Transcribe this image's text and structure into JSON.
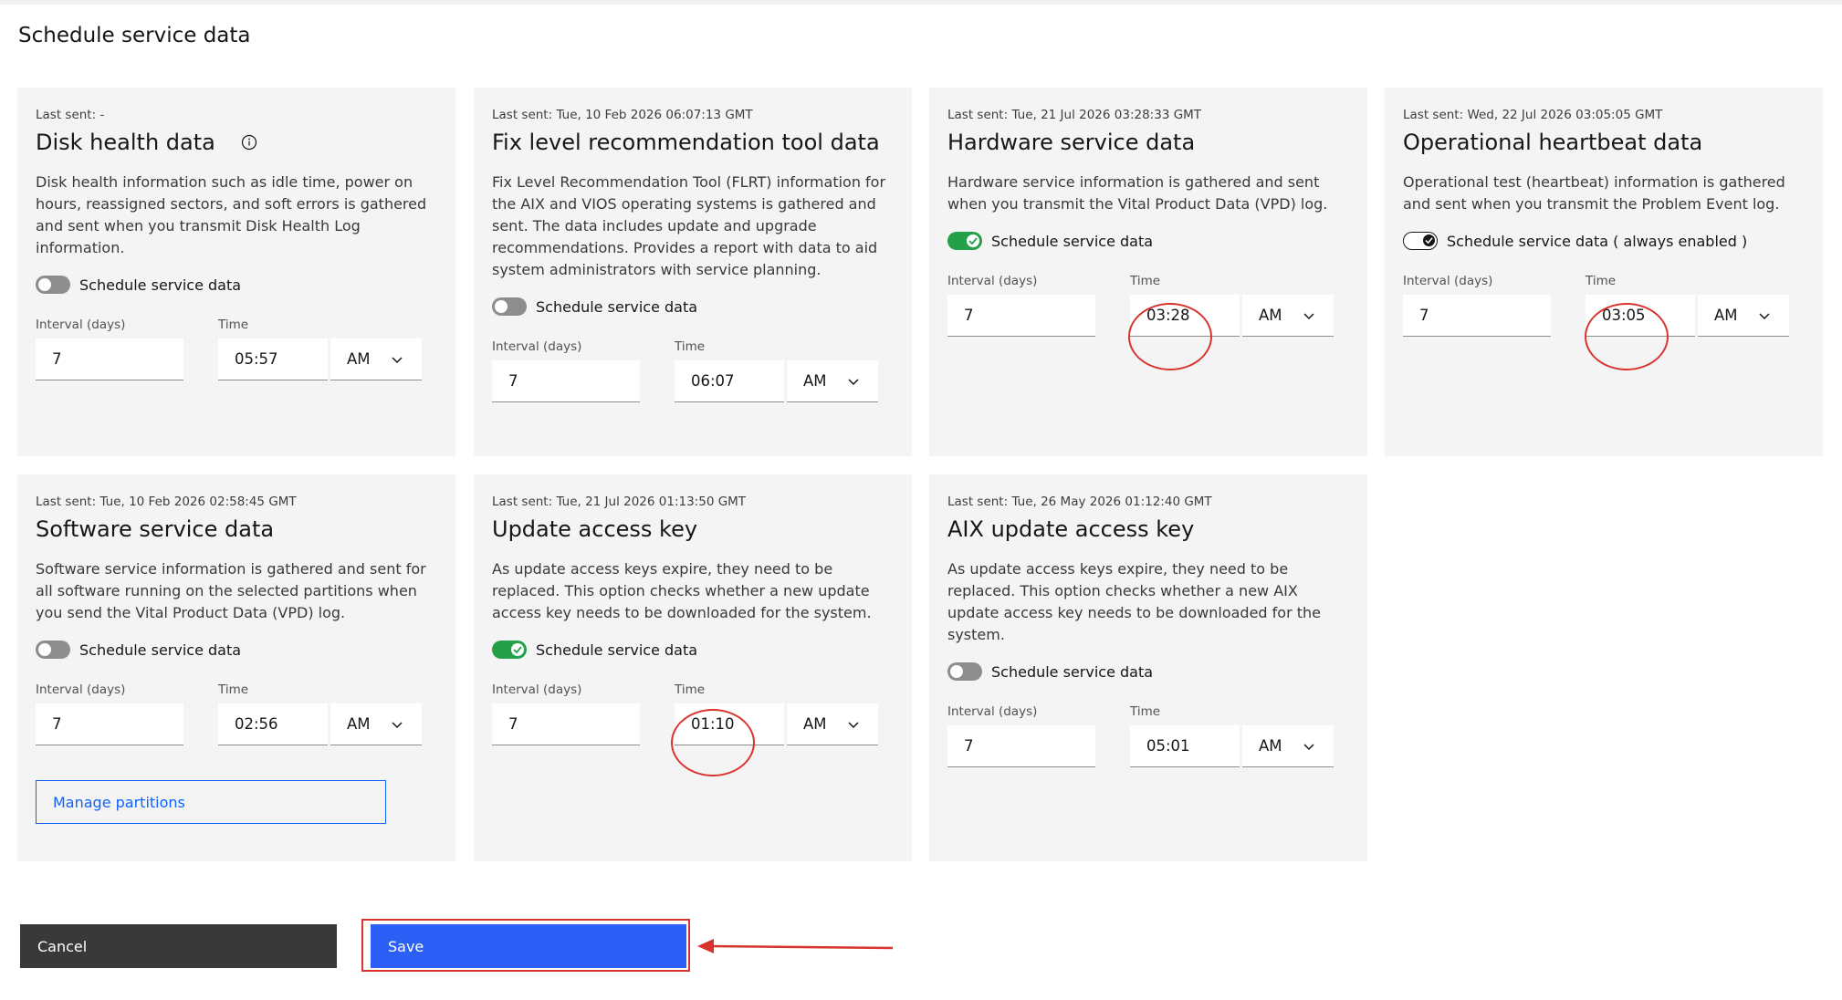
{
  "page": {
    "title": "Schedule service data"
  },
  "cards": {
    "disk": {
      "last_sent": "Last sent: -",
      "title": "Disk health data",
      "description": "Disk health information such as idle time, power on hours, reassigned sectors, and soft errors is gathered and sent when you transmit Disk Health Log information.",
      "toggle_label": "Schedule service data",
      "toggle_on": false,
      "interval_label": "Interval (days)",
      "interval": "7",
      "time_label": "Time",
      "time": "05:57",
      "ampm": "AM"
    },
    "flrt": {
      "last_sent": "Last sent: Tue, 10 Feb 2026 06:07:13 GMT",
      "title": "Fix level recommendation tool data",
      "description": "Fix Level Recommendation Tool (FLRT) information for the AIX and VIOS operating systems is gathered and sent. The data includes update and upgrade recommendations. Provides a report with data to aid system administrators with service planning.",
      "toggle_label": "Schedule service data",
      "toggle_on": false,
      "interval_label": "Interval (days)",
      "interval": "7",
      "time_label": "Time",
      "time": "06:07",
      "ampm": "AM"
    },
    "hardware": {
      "last_sent": "Last sent: Tue, 21 Jul 2026 03:28:33 GMT",
      "title": "Hardware service data",
      "description": "Hardware service information is gathered and sent when you transmit the Vital Product Data (VPD) log.",
      "toggle_label": "Schedule service data",
      "toggle_on": true,
      "interval_label": "Interval (days)",
      "interval": "7",
      "time_label": "Time",
      "time": "03:28",
      "ampm": "AM"
    },
    "heartbeat": {
      "last_sent": "Last sent: Wed, 22 Jul 2026 03:05:05 GMT",
      "title": "Operational heartbeat data",
      "description": "Operational test (heartbeat) information is gathered and sent when you transmit the Problem Event log.",
      "toggle_label": "Schedule service data ( always enabled )",
      "toggle_on": true,
      "interval_label": "Interval (days)",
      "interval": "7",
      "time_label": "Time",
      "time": "03:05",
      "ampm": "AM"
    },
    "software": {
      "last_sent": "Last sent: Tue, 10 Feb 2026 02:58:45 GMT",
      "title": "Software service data",
      "description": "Software service information is gathered and sent for all software running on the selected partitions when you send the Vital Product Data (VPD) log.",
      "toggle_label": "Schedule service data",
      "toggle_on": false,
      "interval_label": "Interval (days)",
      "interval": "7",
      "time_label": "Time",
      "time": "02:56",
      "ampm": "AM",
      "manage_label": "Manage partitions"
    },
    "uak": {
      "last_sent": "Last sent: Tue, 21 Jul 2026 01:13:50 GMT",
      "title": "Update access key",
      "description": "As update access keys expire, they need to be replaced. This option checks whether a new update access key needs to be downloaded for the system.",
      "toggle_label": "Schedule service data",
      "toggle_on": true,
      "interval_label": "Interval (days)",
      "interval": "7",
      "time_label": "Time",
      "time": "01:10",
      "ampm": "AM"
    },
    "aix": {
      "last_sent": "Last sent: Tue, 26 May 2026 01:12:40 GMT",
      "title": "AIX update access key",
      "description": "As update access keys expire, they need to be replaced. This option checks whether a new AIX update access key needs to be downloaded for the system.",
      "toggle_label": "Schedule service data",
      "toggle_on": false,
      "interval_label": "Interval (days)",
      "interval": "7",
      "time_label": "Time",
      "time": "05:01",
      "ampm": "AM"
    }
  },
  "actions": {
    "cancel_label": "Cancel",
    "save_label": "Save"
  },
  "colors": {
    "accent": "#2b5ff5",
    "toggle_on": "#24a148",
    "annotation": "#d9332e",
    "card_bg": "#f4f4f4"
  },
  "icons": {
    "info": "info-icon",
    "chevron": "chevron-down-icon",
    "checkmark": "checkmark-icon",
    "arrow": "arrow-left-icon"
  }
}
